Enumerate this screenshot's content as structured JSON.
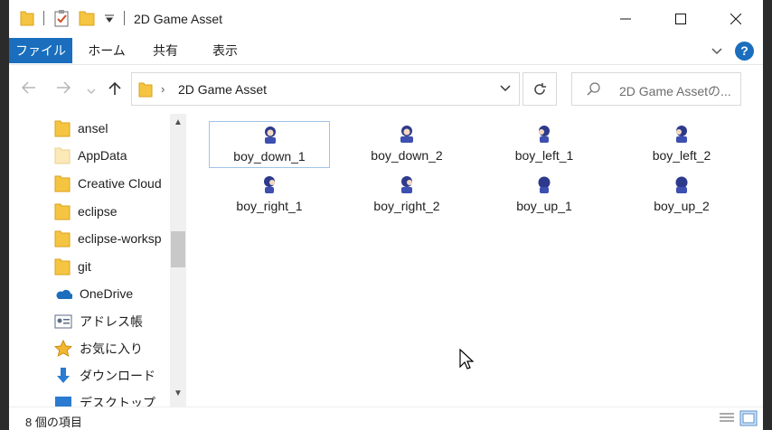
{
  "window": {
    "title": "2D Game Asset",
    "controls": [
      "minimize",
      "maximize",
      "close"
    ]
  },
  "ribbon": {
    "tabs": [
      {
        "label": "ファイル",
        "active": true
      },
      {
        "label": "ホーム"
      },
      {
        "label": "共有"
      },
      {
        "label": "表示"
      }
    ],
    "help_label": "?"
  },
  "address": {
    "path": "2D Game Asset",
    "search_placeholder": "2D Game Assetの..."
  },
  "sidebar": {
    "items": [
      {
        "label": "ansel",
        "icon": "folder-icon"
      },
      {
        "label": "AppData",
        "icon": "folder-icon"
      },
      {
        "label": "Creative Cloud",
        "icon": "folder-icon"
      },
      {
        "label": "eclipse",
        "icon": "folder-icon"
      },
      {
        "label": "eclipse-worksp",
        "icon": "folder-icon"
      },
      {
        "label": "git",
        "icon": "folder-icon"
      },
      {
        "label": "OneDrive",
        "icon": "onedrive-icon"
      },
      {
        "label": "アドレス帳",
        "icon": "contacts-icon"
      },
      {
        "label": "お気に入り",
        "icon": "star-icon"
      },
      {
        "label": "ダウンロード",
        "icon": "download-icon"
      },
      {
        "label": "デスクトップ",
        "icon": "desktop-icon"
      }
    ]
  },
  "files": [
    {
      "name": "boy_down_1",
      "selected": true
    },
    {
      "name": "boy_down_2"
    },
    {
      "name": "boy_left_1"
    },
    {
      "name": "boy_left_2"
    },
    {
      "name": "boy_right_1"
    },
    {
      "name": "boy_right_2"
    },
    {
      "name": "boy_up_1"
    },
    {
      "name": "boy_up_2"
    }
  ],
  "status": {
    "count": "8 個の項目"
  },
  "colors": {
    "accent": "#1a6ebd",
    "folder": "#f5c542",
    "selection_border": "#9fc4e8"
  }
}
